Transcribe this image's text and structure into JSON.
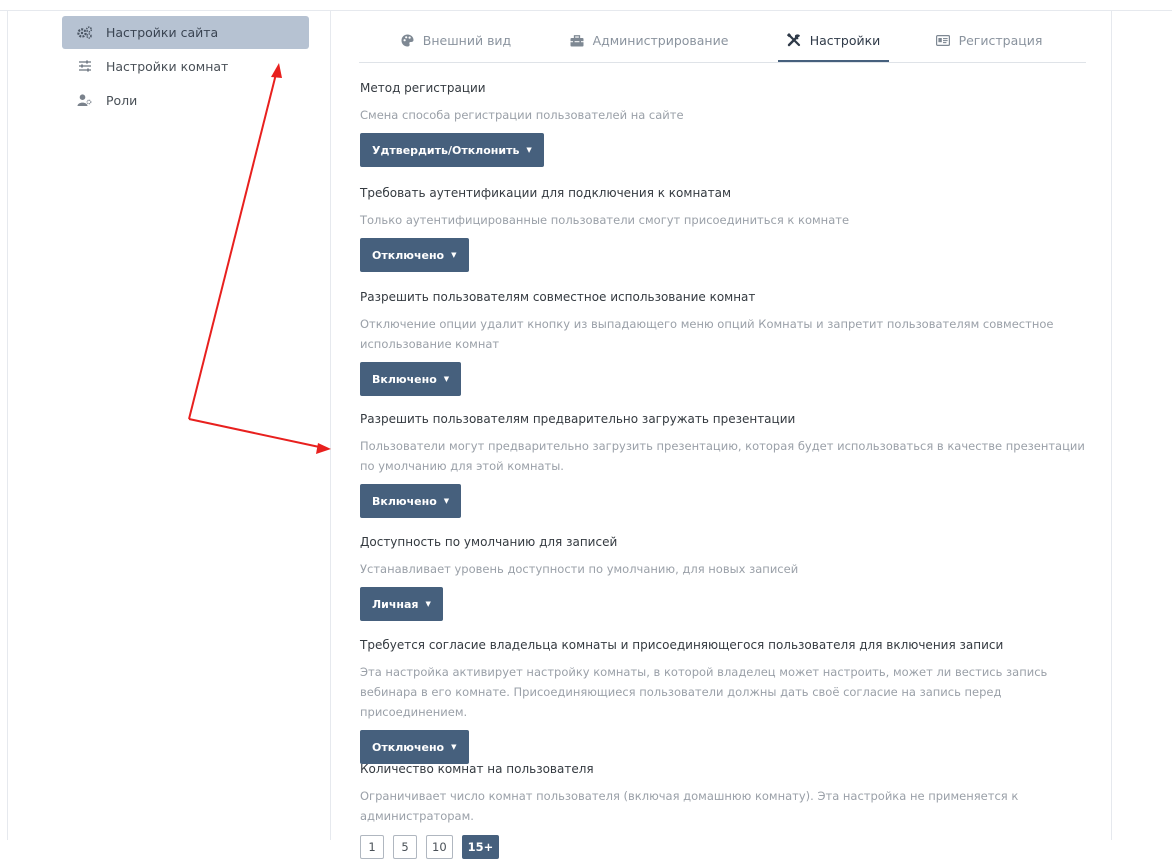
{
  "sidebar": {
    "items": [
      {
        "label": "Настройки сайта",
        "icon": "cogs-icon"
      },
      {
        "label": "Настройки комнат",
        "icon": "sliders-icon"
      },
      {
        "label": "Роли",
        "icon": "users-icon"
      }
    ]
  },
  "tabs": [
    {
      "label": "Внешний вид",
      "icon": "palette-icon"
    },
    {
      "label": "Администрирование",
      "icon": "toolbox-icon"
    },
    {
      "label": "Настройки",
      "icon": "tools-icon"
    },
    {
      "label": "Регистрация",
      "icon": "id-card-icon"
    }
  ],
  "settings": [
    {
      "title": "Метод регистрации",
      "description": "Смена способа регистрации пользователей на сайте",
      "value": "Удтвердить/Отклонить"
    },
    {
      "title": "Требовать аутентификации для подключения к комнатам",
      "description": "Только аутентифицированные пользователи смогут присоединиться к комнате",
      "value": "Отключено"
    },
    {
      "title": "Разрешить пользователям совместное использование комнат",
      "description": "Отключение опции удалит кнопку из выпадающего меню опций Комнаты и запретит пользователям совместное использование комнат",
      "value": "Включено"
    },
    {
      "title": "Разрешить пользователям предварительно загружать презентации",
      "description": "Пользователи могут предварительно загрузить презентацию, которая будет использоваться в качестве презентации по умолчанию для этой комнаты.",
      "value": "Включено"
    },
    {
      "title": "Доступность по умолчанию для записей",
      "description": "Устанавливает уровень доступности по умолчанию, для новых записей",
      "value": "Личная"
    },
    {
      "title": "Требуется согласие владельца комнаты и присоединяющегося пользователя для включения записи",
      "description": "Эта настройка активирует настройку комнаты, в которой владелец может настроить, может ли вестись запись вебинара в его комнате. Присоединяющиеся пользователи должны дать своё согласие на запись перед присоединением.",
      "value": "Отключено"
    }
  ],
  "room_limit": {
    "title": "Количество комнат на пользователя",
    "description": "Ограничивает число комнат пользователя (включая домашнюю комнату). Эта настройка не применяется к администраторам.",
    "options": [
      "1",
      "5",
      "10",
      "15+"
    ]
  },
  "colors": {
    "accent": "#46607d",
    "sidebar_active_bg": "#b6c2d2",
    "annotation_arrow": "#e8201e"
  }
}
